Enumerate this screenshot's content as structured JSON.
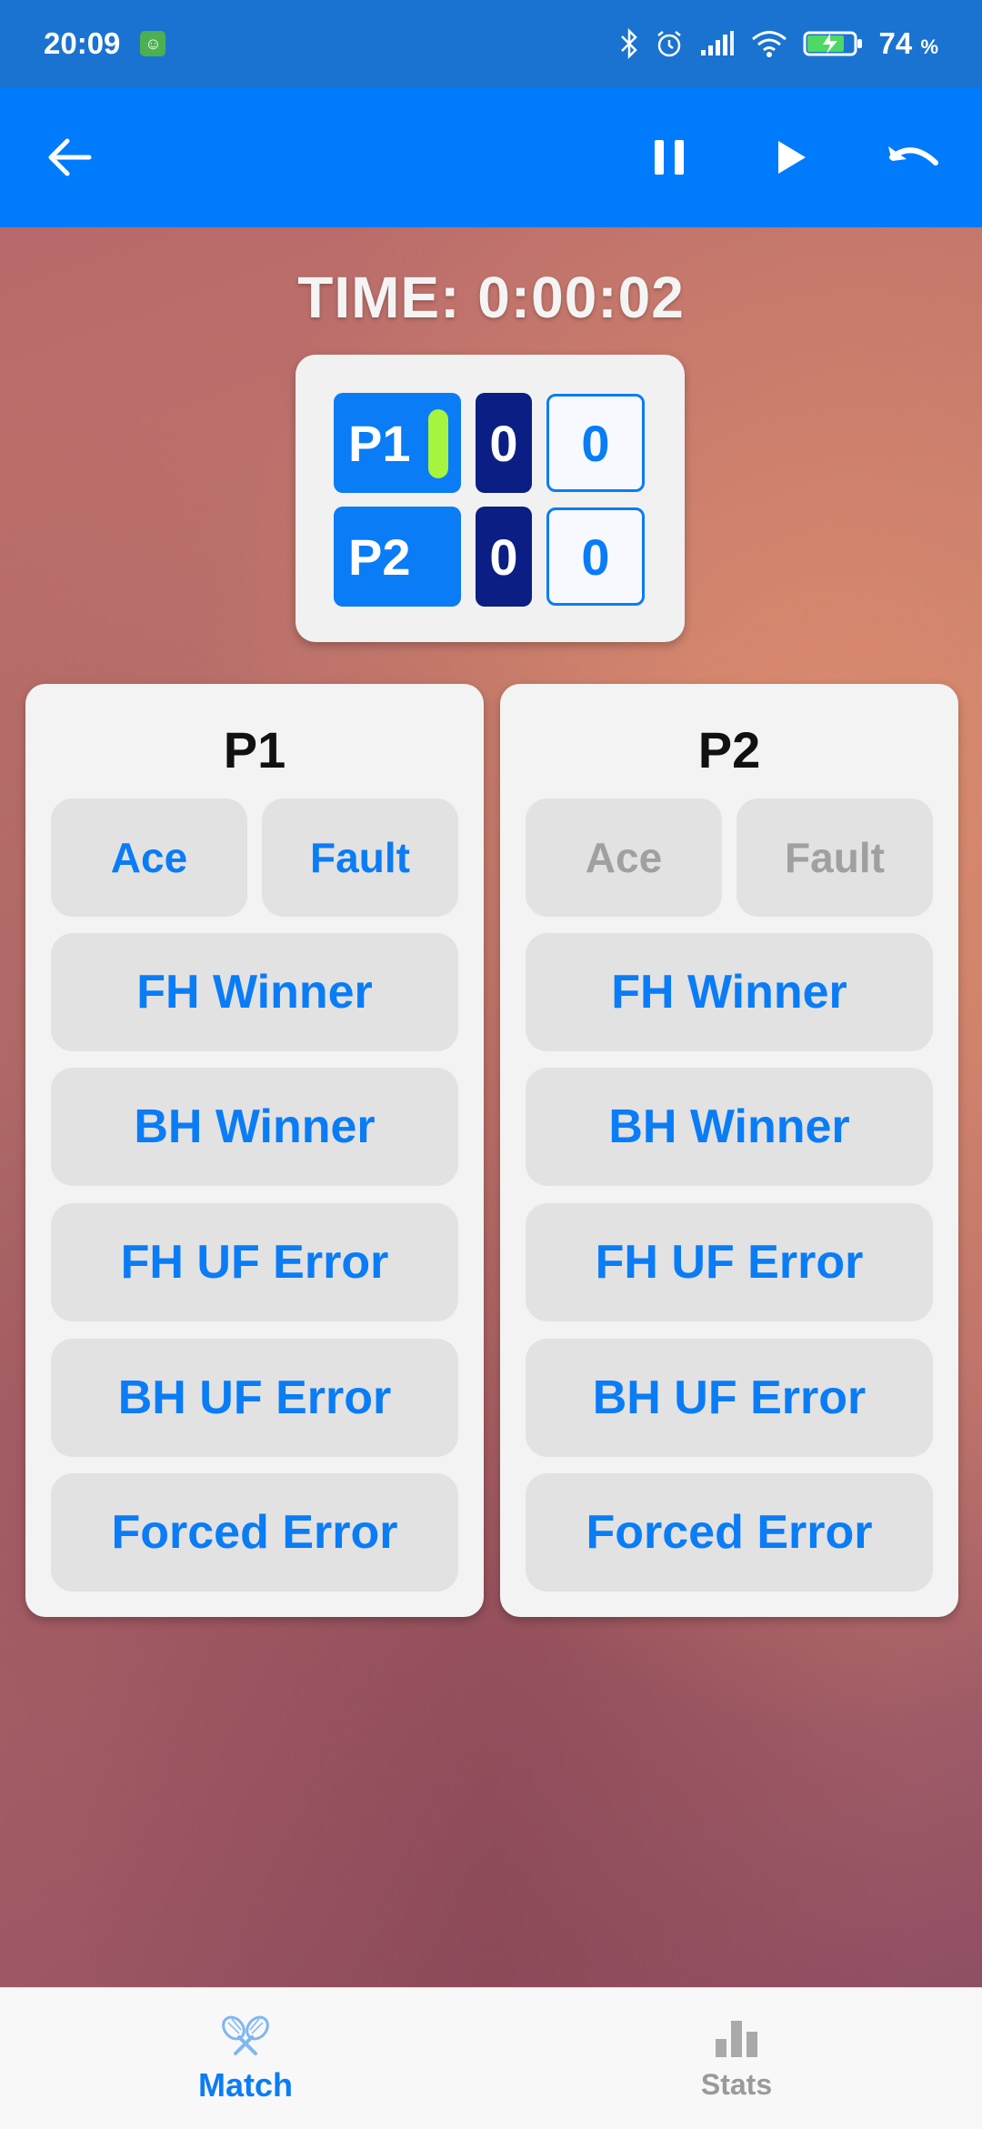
{
  "status_bar": {
    "time": "20:09",
    "battery_percent": "74",
    "percent_sign": "%"
  },
  "timer": {
    "text": "TIME: 0:00:02"
  },
  "scoreboard": {
    "rows": [
      {
        "player": "P1",
        "games": "0",
        "points": "0",
        "serving": true
      },
      {
        "player": "P2",
        "games": "0",
        "points": "0",
        "serving": false
      }
    ]
  },
  "panels": [
    {
      "title": "P1",
      "ace": "Ace",
      "fault": "Fault",
      "serve_enabled": true,
      "buttons": [
        "FH Winner",
        "BH Winner",
        "FH UF Error",
        "BH UF Error",
        "Forced Error"
      ]
    },
    {
      "title": "P2",
      "ace": "Ace",
      "fault": "Fault",
      "serve_enabled": false,
      "buttons": [
        "FH Winner",
        "BH Winner",
        "FH UF Error",
        "BH UF Error",
        "Forced Error"
      ]
    }
  ],
  "bottom_nav": {
    "match_label": "Match",
    "stats_label": "Stats"
  },
  "colors": {
    "app_bar": "#007bfc",
    "accent": "#0a7cf6",
    "serve_indicator": "#a6f43d",
    "games_box": "#0b1e83"
  },
  "icons": {
    "back": "arrow-left-icon",
    "pause": "pause-icon",
    "play": "play-icon",
    "undo": "undo-icon",
    "match": "tennis-rackets-icon",
    "stats": "bar-chart-icon"
  }
}
